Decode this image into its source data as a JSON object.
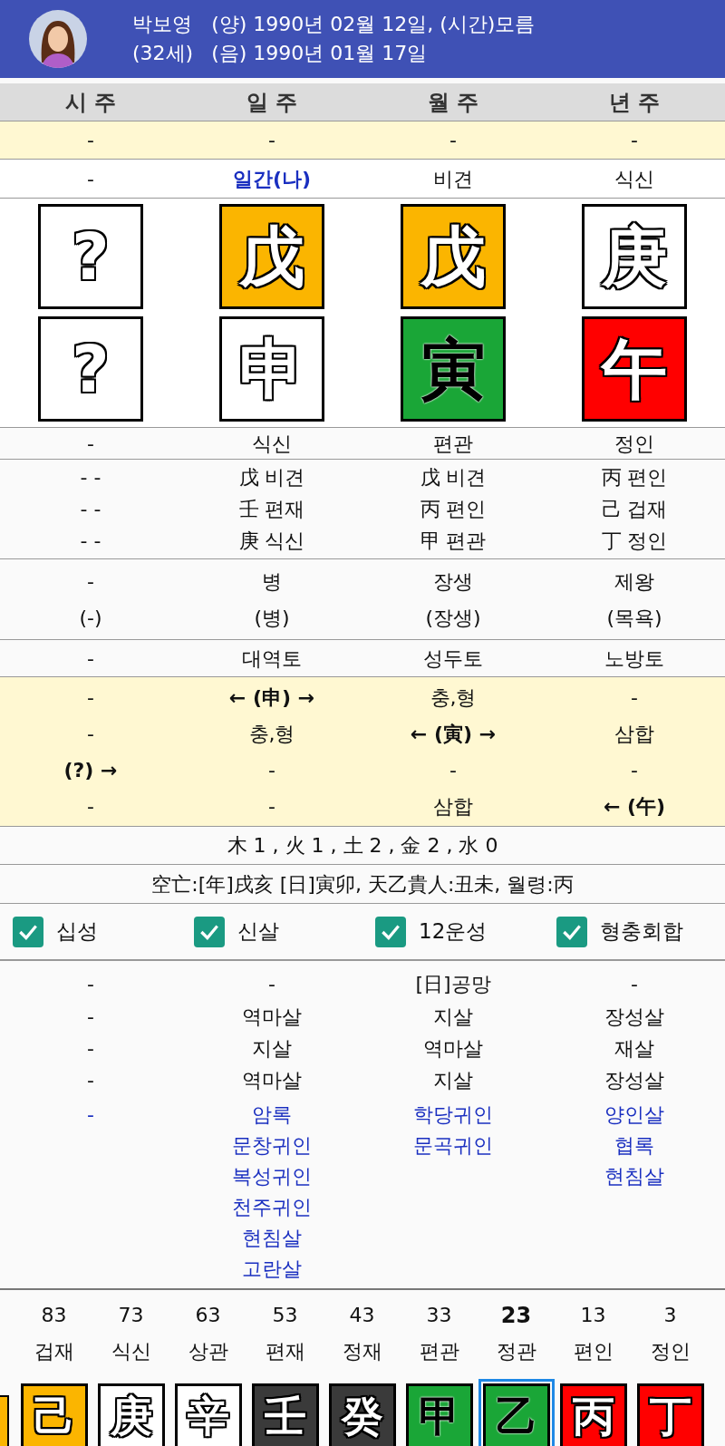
{
  "profile": {
    "name": "박보영",
    "age": "(32세)",
    "solar": "(양) 1990년 02월 12일, (시간)모름",
    "lunar": "(음) 1990년 01월 17일"
  },
  "columns": [
    "시 주",
    "일 주",
    "월 주",
    "년 주"
  ],
  "top_row": [
    "-",
    "-",
    "-",
    "-"
  ],
  "stem_gods": [
    {
      "text": "-",
      "self": false
    },
    {
      "text": "일간(나)",
      "self": true
    },
    {
      "text": "비견",
      "self": false
    },
    {
      "text": "식신",
      "self": false
    }
  ],
  "stems": [
    {
      "char": "?",
      "color": "#ffffff"
    },
    {
      "char": "戊",
      "color": "#fbb500"
    },
    {
      "char": "戊",
      "color": "#fbb500"
    },
    {
      "char": "庚",
      "color": "#ffffff"
    }
  ],
  "branches": [
    {
      "char": "?",
      "color": "#ffffff"
    },
    {
      "char": "申",
      "color": "#ffffff"
    },
    {
      "char": "寅",
      "color": "#1aa637"
    },
    {
      "char": "午",
      "color": "#ff0000"
    }
  ],
  "branch_gods": [
    "-",
    "식신",
    "편관",
    "정인"
  ],
  "hidden_stems": [
    [
      "- -",
      "戊 비견",
      "戊 비견",
      "丙 편인"
    ],
    [
      "- -",
      "壬 편재",
      "丙 편인",
      "己 겁재"
    ],
    [
      "- -",
      "庚 식신",
      "甲 편관",
      "丁 정인"
    ]
  ],
  "twelve_stages": [
    [
      "-",
      "병",
      "장생",
      "제왕"
    ],
    [
      "(-)",
      "(병)",
      "(장생)",
      "(목욕)"
    ]
  ],
  "napeum": [
    "-",
    "대역토",
    "성두토",
    "노방토"
  ],
  "relations": [
    [
      {
        "text": "-",
        "bold": false
      },
      {
        "text": "← (申) →",
        "bold": true
      },
      {
        "text": "충,형",
        "bold": false
      },
      {
        "text": "-",
        "bold": false
      }
    ],
    [
      {
        "text": "-",
        "bold": false
      },
      {
        "text": "충,형",
        "bold": false
      },
      {
        "text": "← (寅) →",
        "bold": true
      },
      {
        "text": "삼합",
        "bold": false
      }
    ],
    [
      {
        "text": "(?) →",
        "bold": true
      },
      {
        "text": "-",
        "bold": false
      },
      {
        "text": "-",
        "bold": false
      },
      {
        "text": "-",
        "bold": false
      }
    ],
    [
      {
        "text": "-",
        "bold": false
      },
      {
        "text": "-",
        "bold": false
      },
      {
        "text": "삼합",
        "bold": false
      },
      {
        "text": "← (午)",
        "bold": true
      }
    ]
  ],
  "elements": "木 1 , 火 1 , 土 2 , 金 2 , 水 0",
  "void_line": "空亡:[年]戌亥 [日]寅卯, 天乙貴人:丑未, 월령:丙",
  "options": [
    {
      "label": "십성",
      "checked": true
    },
    {
      "label": "신살",
      "checked": true
    },
    {
      "label": "12운성",
      "checked": true
    },
    {
      "label": "형충회합",
      "checked": true
    }
  ],
  "shinsal_rows": [
    [
      "-",
      "-",
      "[日]공망",
      "-"
    ],
    [
      "-",
      "역마살",
      "지살",
      "장성살"
    ],
    [
      "-",
      "지살",
      "역마살",
      "재살"
    ],
    [
      "-",
      "역마살",
      "지살",
      "장성살"
    ]
  ],
  "lucky_stars": [
    [
      "-"
    ],
    [
      "암록",
      "문창귀인",
      "복성귀인",
      "천주귀인",
      "현침살",
      "고란살"
    ],
    [
      "학당귀인",
      "문곡귀인"
    ],
    [
      "양인살",
      "협록",
      "현침살"
    ]
  ],
  "luck_cycles": [
    {
      "age": "83",
      "god": "겁재",
      "char": "己",
      "color": "#fbb500",
      "selected": false
    },
    {
      "age": "73",
      "god": "식신",
      "char": "庚",
      "color": "#ffffff",
      "selected": false
    },
    {
      "age": "63",
      "god": "상관",
      "char": "辛",
      "color": "#ffffff",
      "selected": false
    },
    {
      "age": "53",
      "god": "편재",
      "char": "壬",
      "color": "#3a3a3a",
      "selected": false
    },
    {
      "age": "43",
      "god": "정재",
      "char": "癸",
      "color": "#3a3a3a",
      "selected": false
    },
    {
      "age": "33",
      "god": "편관",
      "char": "甲",
      "color": "#1aa637",
      "selected": false
    },
    {
      "age": "23",
      "god": "정관",
      "char": "乙",
      "color": "#1aa637",
      "selected": true
    },
    {
      "age": "13",
      "god": "편인",
      "char": "丙",
      "color": "#ff0000",
      "selected": false
    },
    {
      "age": "3",
      "god": "정인",
      "char": "丁",
      "color": "#ff0000",
      "selected": false
    }
  ]
}
